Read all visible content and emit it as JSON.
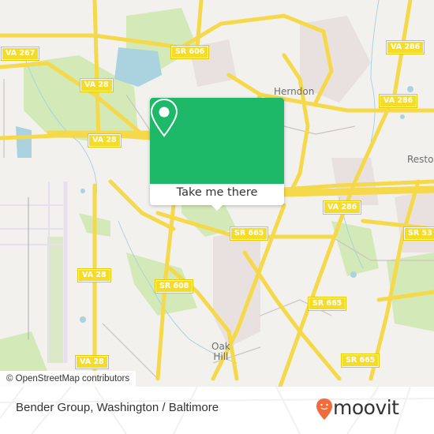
{
  "map": {
    "attribution": "© OpenStreetMap contributors",
    "place_labels": [
      {
        "id": "herndon",
        "text": "Herndon"
      },
      {
        "id": "reston",
        "text": "Resto"
      },
      {
        "id": "oak-hill",
        "text": "Oak\nHill"
      }
    ],
    "route_shields": [
      {
        "id": "va267",
        "text": "VA 267"
      },
      {
        "id": "sr606",
        "text": "SR 606"
      },
      {
        "id": "va28-a",
        "text": "VA 28"
      },
      {
        "id": "va28-b",
        "text": "VA 28"
      },
      {
        "id": "va28-c",
        "text": "VA 28"
      },
      {
        "id": "va28-d",
        "text": "VA 28"
      },
      {
        "id": "va286-a",
        "text": "VA 286"
      },
      {
        "id": "va286-b",
        "text": "VA 286"
      },
      {
        "id": "va286-c",
        "text": "VA 286"
      },
      {
        "id": "sr608",
        "text": "SR 608"
      },
      {
        "id": "sr665-a",
        "text": "SR 665"
      },
      {
        "id": "sr665-b",
        "text": "SR 665"
      },
      {
        "id": "sr665-c",
        "text": "SR 665"
      },
      {
        "id": "sr53x",
        "text": "SR 53"
      }
    ],
    "colors": {
      "road": "#f7e15c",
      "water": "#aad3df",
      "park": "#cfe8b0",
      "background": "#f2f1ee"
    }
  },
  "popup": {
    "button_label": "Take me there",
    "color": "#1db969"
  },
  "footer": {
    "title": "Bender Group, Washington / Baltimore",
    "logo_text": "moovit",
    "logo_color": "#f26b3a"
  }
}
